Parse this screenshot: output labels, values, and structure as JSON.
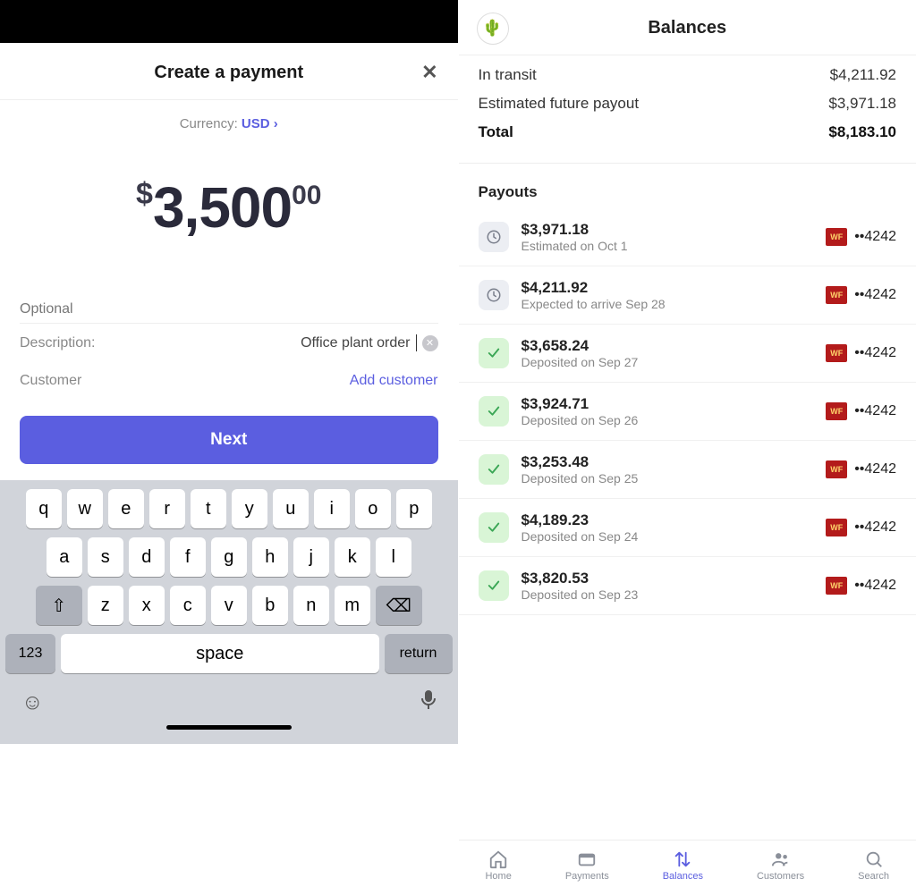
{
  "left": {
    "modal_title": "Create a payment",
    "close_glyph": "✕",
    "currency_label": "Currency:",
    "currency_value": "USD",
    "chevron": "›",
    "amount_sign": "$",
    "amount_major": "3,500",
    "amount_minor": "00",
    "optional_label": "Optional",
    "description_label": "Description:",
    "description_value": "Office plant order",
    "customer_label": "Customer",
    "add_customer": "Add customer",
    "next_label": "Next",
    "keyboard": {
      "row1": [
        "q",
        "w",
        "e",
        "r",
        "t",
        "y",
        "u",
        "i",
        "o",
        "p"
      ],
      "row2": [
        "a",
        "s",
        "d",
        "f",
        "g",
        "h",
        "j",
        "k",
        "l"
      ],
      "row3": [
        "z",
        "x",
        "c",
        "v",
        "b",
        "n",
        "m"
      ],
      "shift": "⇧",
      "backspace": "⌫",
      "num": "123",
      "space": "space",
      "return": "return",
      "emoji": "☺",
      "mic": "🎤"
    }
  },
  "right": {
    "avatar_glyph": "🌵",
    "title": "Balances",
    "summary": {
      "in_transit_label": "In transit",
      "in_transit_value": "$4,211.92",
      "future_label": "Estimated future payout",
      "future_value": "$3,971.18",
      "total_label": "Total",
      "total_value": "$8,183.10"
    },
    "payouts_title": "Payouts",
    "bank_name": "WF",
    "account_mask": "••4242",
    "payouts": [
      {
        "icon": "clock",
        "amount": "$3,971.18",
        "sub": "Estimated on Oct 1"
      },
      {
        "icon": "clock",
        "amount": "$4,211.92",
        "sub": "Expected to arrive Sep 28"
      },
      {
        "icon": "check",
        "amount": "$3,658.24",
        "sub": "Deposited on Sep 27"
      },
      {
        "icon": "check",
        "amount": "$3,924.71",
        "sub": "Deposited on Sep 26"
      },
      {
        "icon": "check",
        "amount": "$3,253.48",
        "sub": "Deposited on Sep 25"
      },
      {
        "icon": "check",
        "amount": "$4,189.23",
        "sub": "Deposited on Sep 24"
      },
      {
        "icon": "check",
        "amount": "$3,820.53",
        "sub": "Deposited on Sep 23"
      }
    ],
    "tabs": [
      {
        "id": "home",
        "label": "Home"
      },
      {
        "id": "payments",
        "label": "Payments"
      },
      {
        "id": "balances",
        "label": "Balances"
      },
      {
        "id": "customers",
        "label": "Customers"
      },
      {
        "id": "search",
        "label": "Search"
      }
    ],
    "active_tab": "balances"
  }
}
